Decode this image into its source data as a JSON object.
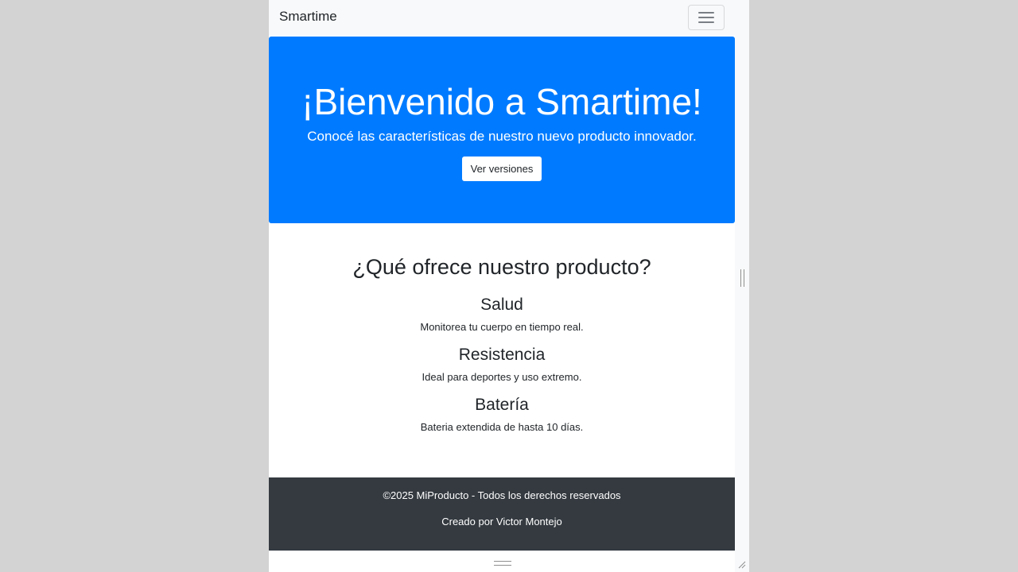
{
  "navbar": {
    "brand": "Smartime",
    "toggler_icon": "hamburger-icon"
  },
  "hero": {
    "title": "¡Bienvenido a Smartime!",
    "subtitle": "Conocé las características de nuestro nuevo producto innovador.",
    "button_label": "Ver versiones"
  },
  "features": {
    "title": "¿Qué ofrece nuestro producto?",
    "items": [
      {
        "name": "Salud",
        "description": "Monitorea tu cuerpo en tiempo real."
      },
      {
        "name": "Resistencia",
        "description": "Ideal para deportes y uso extremo."
      },
      {
        "name": "Batería",
        "description": "Bateria extendida de hasta 10 días."
      }
    ]
  },
  "footer": {
    "copyright": "©2025 MiProducto - Todos los derechos reservados",
    "credit": "Creado por Victor Montejo"
  },
  "colors": {
    "primary": "#007bff",
    "navbar_bg": "#f8f9fa",
    "footer_bg": "#343a40",
    "outer_bg": "#d3d3d3"
  }
}
